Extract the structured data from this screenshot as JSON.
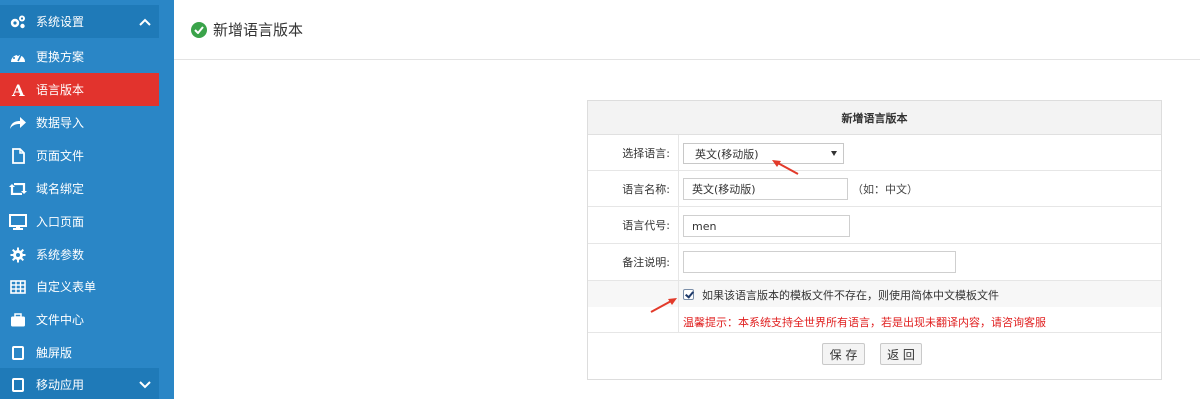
{
  "sidebar": {
    "items": [
      {
        "label": "系统设置",
        "icon": "gears-icon"
      },
      {
        "label": "更换方案",
        "icon": "dashboard-icon"
      },
      {
        "label": "语言版本",
        "icon": "font-a-icon"
      },
      {
        "label": "数据导入",
        "icon": "share-arrow-icon"
      },
      {
        "label": "页面文件",
        "icon": "file-icon"
      },
      {
        "label": "域名绑定",
        "icon": "retweet-icon"
      },
      {
        "label": "入口页面",
        "icon": "monitor-icon"
      },
      {
        "label": "系统参数",
        "icon": "gear-icon"
      },
      {
        "label": "自定义表单",
        "icon": "table-icon"
      },
      {
        "label": "文件中心",
        "icon": "briefcase-icon"
      },
      {
        "label": "触屏版",
        "icon": "tablet-icon"
      },
      {
        "label": "移动应用",
        "icon": "tablet-icon"
      }
    ],
    "colors": {
      "bg": "#2a86c6",
      "header": "#1f7ab8",
      "active": "#e2332d"
    }
  },
  "header": {
    "title": "新增语言版本",
    "icon": "check-circle-icon",
    "icon_color": "#3aa34a"
  },
  "form": {
    "title": "新增语言版本",
    "language_label": "选择语言:",
    "language_selected": "英文(移动版)",
    "name_label": "语言名称:",
    "name_value": "英文(移动版)",
    "name_hint": "（如：中文）",
    "code_label": "语言代号:",
    "code_value": "men",
    "note_label": "备注说明:",
    "note_value": "",
    "fallback_checkbox": "如果该语言版本的模板文件不存在，则使用简体中文模板文件",
    "fallback_checked": true,
    "warning": "温馨提示：本系统支持全世界所有语言，若是出现未翻译内容，请咨询客服",
    "save_label": "保 存",
    "back_label": "返 回"
  }
}
